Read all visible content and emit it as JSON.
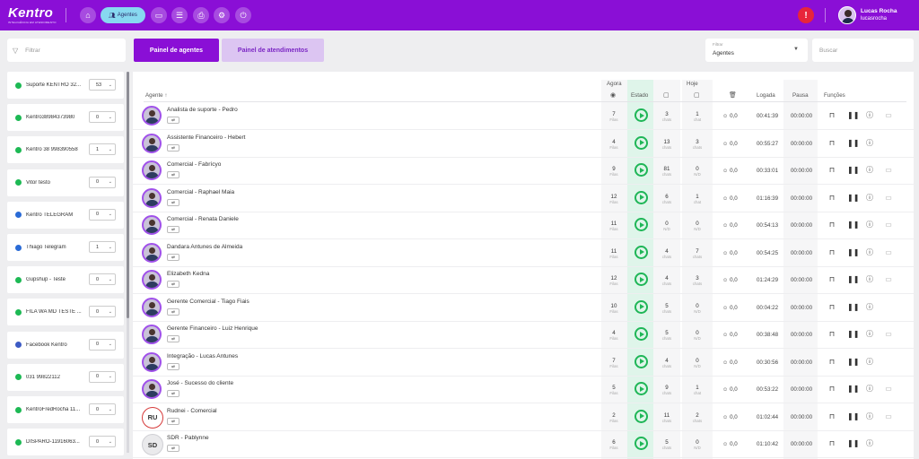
{
  "app": {
    "logo": "Kentro",
    "logo_tagline": "INTELIGÊNCIA EM ATENDIMENTO"
  },
  "topbar": {
    "nav": [
      {
        "icon": "dashboard-icon"
      },
      {
        "icon": "agents-icon",
        "label": "Agentes",
        "active": true
      },
      {
        "icon": "monitor-icon"
      },
      {
        "icon": "report-icon"
      },
      {
        "icon": "printer-icon"
      },
      {
        "icon": "settings-icon"
      },
      {
        "icon": "power-icon"
      }
    ],
    "alert_icon": "alert-icon",
    "user": {
      "name": "Lucas Rocha",
      "login": "lucasrocha"
    }
  },
  "sidebar": {
    "filter_placeholder": "Filtrar",
    "items": [
      {
        "label": "Suporte KENTRO 32...",
        "value": "53",
        "color": "#1db954"
      },
      {
        "label": "Kentro38984373980",
        "value": "0",
        "color": "#1db954"
      },
      {
        "label": "Kentro 38 998390558",
        "value": "1",
        "color": "#1db954"
      },
      {
        "label": "Vitor testo",
        "value": "0",
        "color": "#1db954"
      },
      {
        "label": "Kentro TELEGRAM",
        "value": "0",
        "color": "#2a6bd6"
      },
      {
        "label": "Thiago Telegram",
        "value": "1",
        "color": "#2a6bd6"
      },
      {
        "label": "Gupshup - Teste",
        "value": "0",
        "color": "#1db954"
      },
      {
        "label": "FILA WA MD TESTE ...",
        "value": "0",
        "color": "#1db954"
      },
      {
        "label": "Facebook Kentro",
        "value": "0",
        "color": "#3d5bc4"
      },
      {
        "label": "031 99822112",
        "value": "0",
        "color": "#1db954"
      },
      {
        "label": "KentroFredRocha 11...",
        "value": "0",
        "color": "#1db954"
      },
      {
        "label": "DISPARO-11916063...",
        "value": "0",
        "color": "#1db954"
      }
    ]
  },
  "tabs": {
    "agents": "Painel de agentes",
    "attendance": "Painel de atendimentos"
  },
  "filter": {
    "label": "Filtrar",
    "value": "Agentes"
  },
  "search": {
    "placeholder": "Buscar"
  },
  "table": {
    "group_now": "Agora",
    "group_today": "Hoje",
    "col_agent": "Agente",
    "col_state": "Estado",
    "col_logged": "Logada",
    "col_pause": "Pausa",
    "col_functions": "Funções",
    "rows": [
      {
        "name": "Analista de suporte - Pedro",
        "queues": "7",
        "queues_unit": "Filas",
        "chats_now": "3",
        "chats_now_unit": "chats",
        "chats_today": "1",
        "chats_today_unit": "chat",
        "score": "0,0",
        "logged": "00:41:39",
        "pause": "00:00:00",
        "monitor": true
      },
      {
        "name": "Assistente Financeiro - Hebert",
        "queues": "4",
        "queues_unit": "Filas",
        "chats_now": "13",
        "chats_now_unit": "chats",
        "chats_today": "3",
        "chats_today_unit": "chats",
        "score": "0,0",
        "logged": "00:55:27",
        "pause": "00:00:00",
        "monitor": false
      },
      {
        "name": "Comercial - Fabrícyo",
        "queues": "9",
        "queues_unit": "Filas",
        "chats_now": "81",
        "chats_now_unit": "chats",
        "chats_today": "0",
        "chats_today_unit": "N/D",
        "score": "0,0",
        "logged": "00:33:01",
        "pause": "00:00:00",
        "monitor": true
      },
      {
        "name": "Comercial - Raphael Maia",
        "queues": "12",
        "queues_unit": "Filas",
        "chats_now": "6",
        "chats_now_unit": "chats",
        "chats_today": "1",
        "chats_today_unit": "chat",
        "score": "0,0",
        "logged": "01:16:39",
        "pause": "00:00:00",
        "monitor": true
      },
      {
        "name": "Comercial - Renata Daniele",
        "queues": "11",
        "queues_unit": "Filas",
        "chats_now": "0",
        "chats_now_unit": "N/D",
        "chats_today": "0",
        "chats_today_unit": "N/D",
        "score": "0,0",
        "logged": "00:54:13",
        "pause": "00:00:00",
        "monitor": true
      },
      {
        "name": "Dandara Antunes de Almeida",
        "queues": "11",
        "queues_unit": "Filas",
        "chats_now": "4",
        "chats_now_unit": "chats",
        "chats_today": "7",
        "chats_today_unit": "chats",
        "score": "0,0",
        "logged": "00:54:25",
        "pause": "00:00:00",
        "monitor": true
      },
      {
        "name": "Elizabeth Kedna",
        "queues": "12",
        "queues_unit": "Filas",
        "chats_now": "4",
        "chats_now_unit": "chats",
        "chats_today": "3",
        "chats_today_unit": "chats",
        "score": "0,0",
        "logged": "01:24:29",
        "pause": "00:00:00",
        "monitor": true
      },
      {
        "name": "Gerente Comercial - Tiago Fiais",
        "queues": "10",
        "queues_unit": "Filas",
        "chats_now": "5",
        "chats_now_unit": "chats",
        "chats_today": "0",
        "chats_today_unit": "N/D",
        "score": "0,0",
        "logged": "00:04:22",
        "pause": "00:00:00",
        "monitor": false
      },
      {
        "name": "Gerente Financeiro - Luiz Henrique",
        "queues": "4",
        "queues_unit": "Filas",
        "chats_now": "5",
        "chats_now_unit": "chats",
        "chats_today": "0",
        "chats_today_unit": "N/D",
        "score": "0,0",
        "logged": "00:38:48",
        "pause": "00:00:00",
        "monitor": true
      },
      {
        "name": "Integração - Lucas Antunes",
        "queues": "7",
        "queues_unit": "Filas",
        "chats_now": "4",
        "chats_now_unit": "chats",
        "chats_today": "0",
        "chats_today_unit": "N/D",
        "score": "0,0",
        "logged": "00:30:56",
        "pause": "00:00:00",
        "monitor": false
      },
      {
        "name": "José - Sucesso do cliente",
        "queues": "5",
        "queues_unit": "Filas",
        "chats_now": "9",
        "chats_now_unit": "chats",
        "chats_today": "1",
        "chats_today_unit": "chat",
        "score": "0,0",
        "logged": "00:53:22",
        "pause": "00:00:00",
        "monitor": true
      },
      {
        "name": "Rudnei - Comercial",
        "initials": "RU",
        "queues": "2",
        "queues_unit": "Filas",
        "chats_now": "11",
        "chats_now_unit": "chats",
        "chats_today": "2",
        "chats_today_unit": "chats",
        "score": "0,0",
        "logged": "01:02:44",
        "pause": "00:00:00",
        "monitor": true
      },
      {
        "name": "SDR - Pablynne",
        "initials": "SD",
        "queues": "6",
        "queues_unit": "Filas",
        "chats_now": "5",
        "chats_now_unit": "chats",
        "chats_today": "0",
        "chats_today_unit": "N/D",
        "score": "0,0",
        "logged": "01:10:42",
        "pause": "00:00:00",
        "monitor": false
      }
    ]
  },
  "colors": {
    "brand": "#8a0fd6",
    "tab_inactive": "#dcc5f2",
    "state_green": "#1fb657",
    "alert": "#e8253a"
  }
}
